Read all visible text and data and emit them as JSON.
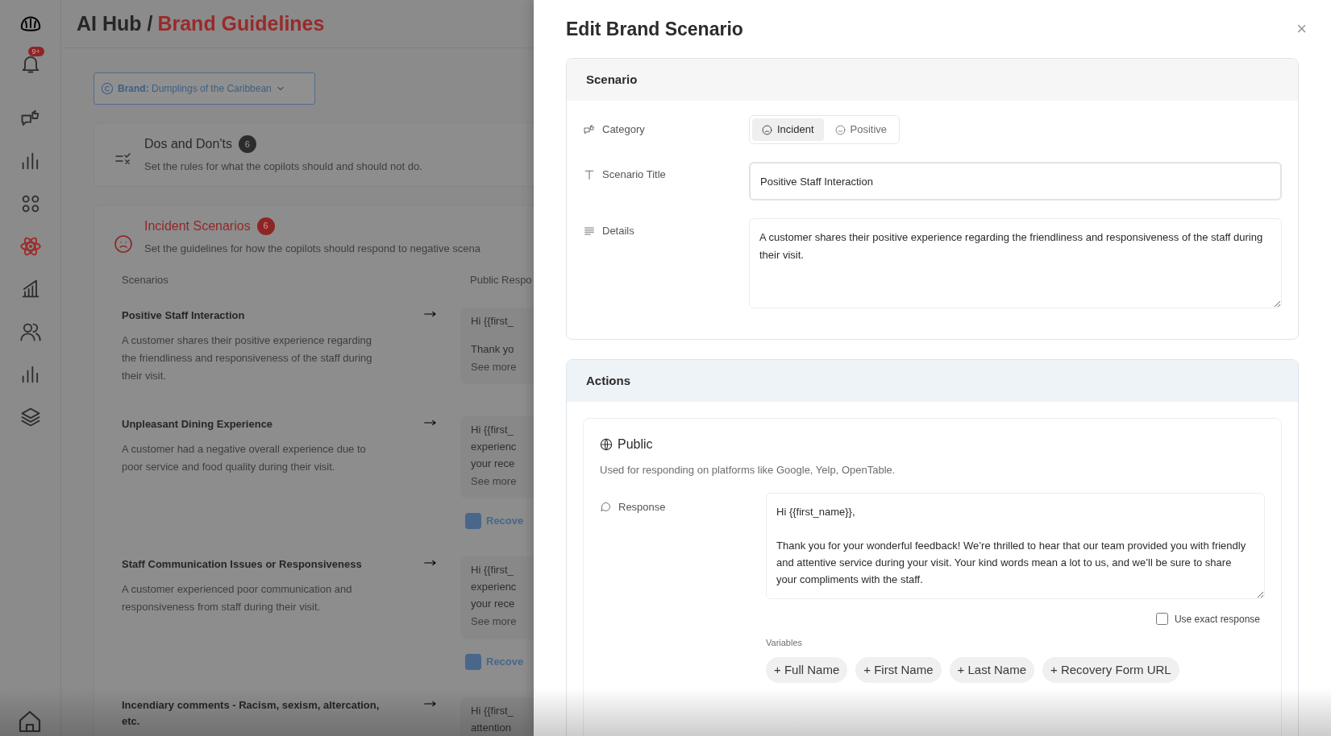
{
  "sidebar": {
    "items": [
      {
        "selected": false,
        "badge": "9+"
      },
      {
        "selected": false
      },
      {
        "selected": false
      },
      {
        "selected": false
      },
      {
        "selected": true
      },
      {
        "selected": false
      },
      {
        "selected": false
      },
      {
        "selected": false
      },
      {
        "selected": false
      }
    ]
  },
  "header": {
    "section": "AI Hub /",
    "page": "Brand Guidelines"
  },
  "brand_selector": {
    "label": "Brand:",
    "value": "Dumplings of the Caribbean"
  },
  "sections": [
    {
      "kind": "rules",
      "title": "Dos and Don'ts",
      "count": "6",
      "description": "Set the rules for what the copilots should and should not do."
    },
    {
      "kind": "incident",
      "title": "Incident Scenarios",
      "count": "6",
      "description": "Set the guidelines for how the copilots should respond to negative scena"
    }
  ],
  "scenarios_table": {
    "columns": [
      "Scenarios",
      "Public Respo"
    ],
    "rows": [
      {
        "title": "Positive Staff Interaction",
        "description": "A customer shares their positive experience regarding the friendliness and responsiveness of the staff during their visit.",
        "response": [
          [
            "Hi {{first_"
          ],
          [
            "Thank yo"
          ]
        ],
        "see_more": "See more"
      },
      {
        "title": "Unpleasant Dining Experience",
        "description": "A customer had a negative overall experience due to poor service and food quality during their visit.",
        "response": [
          [
            "Hi {{first_",
            "experienc",
            "your rece"
          ]
        ],
        "see_more": "See more",
        "recovery": "Recove"
      },
      {
        "title": "Staff Communication Issues or Responsiveness",
        "description": "A customer experienced poor communication and responsiveness from staff during their visit.",
        "response": [
          [
            "Hi {{first_",
            "experienc",
            "your rece"
          ]
        ],
        "see_more": "See more",
        "recovery": "Recove"
      },
      {
        "title": "Incendiary comments - Racism, sexism, altercation, etc.",
        "response": [
          [
            "Hi {{first_",
            "attention"
          ]
        ]
      }
    ]
  },
  "drawer": {
    "title": "Edit Brand Scenario",
    "close": "×",
    "scenario": {
      "heading": "Scenario",
      "category": {
        "label": "Category",
        "options": [
          {
            "label": "Incident",
            "selected": true
          },
          {
            "label": "Positive",
            "selected": false
          }
        ]
      },
      "scenario_title": {
        "label": "Scenario Title",
        "value": "Positive Staff Interaction"
      },
      "details": {
        "label": "Details",
        "value": "A customer shares their positive experience regarding the friendliness and responsiveness of the staff during their visit."
      }
    },
    "actions": {
      "heading": "Actions",
      "public": {
        "title": "Public",
        "description": "Used for responding on platforms like Google, Yelp, OpenTable.",
        "response": {
          "label": "Response",
          "value": "Hi {{first_name}},\n\nThank you for your wonderful feedback! We’re thrilled to hear that our team provided you with friendly and attentive service during your visit. Your kind words mean a lot to us, and we’ll be sure to share your compliments with the staff."
        },
        "use_exact_response": {
          "label": "Use exact response",
          "checked": false
        },
        "variables": {
          "label": "Variables",
          "chips": [
            "+ Full Name",
            "+ First Name",
            "+ Last Name",
            "+ Recovery Form URL"
          ]
        }
      }
    }
  }
}
